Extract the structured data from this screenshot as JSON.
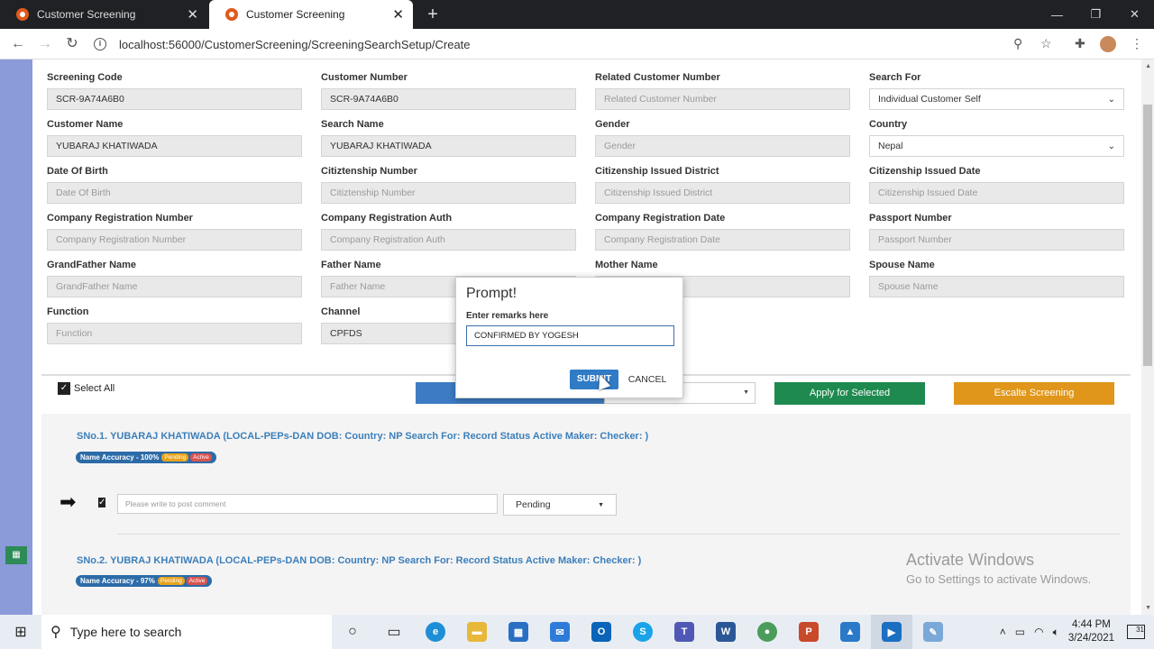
{
  "browser": {
    "tabs": [
      {
        "title": "Customer Screening",
        "active": false
      },
      {
        "title": "Customer Screening",
        "active": true
      }
    ],
    "url": "localhost:56000/CustomerScreening/ScreeningSearchSetup/Create"
  },
  "form": {
    "fields": [
      {
        "label": "Screening Code",
        "value": "SCR-9A74A6B0",
        "placeholder": false
      },
      {
        "label": "Customer Number",
        "value": "SCR-9A74A6B0",
        "placeholder": false
      },
      {
        "label": "Related Customer Number",
        "value": "Related Customer Number",
        "placeholder": true
      },
      {
        "label": "Search For",
        "value": "Individual Customer Self",
        "select": true
      },
      {
        "label": "Customer Name",
        "value": "YUBARAJ KHATIWADA",
        "placeholder": false
      },
      {
        "label": "Search Name",
        "value": "YUBARAJ KHATIWADA",
        "placeholder": false
      },
      {
        "label": "Gender",
        "value": "Gender",
        "placeholder": true
      },
      {
        "label": "Country",
        "value": "Nepal",
        "select": true
      },
      {
        "label": "Date Of Birth",
        "value": "Date Of Birth",
        "placeholder": true
      },
      {
        "label": "Citiztenship Number",
        "value": "Citiztenship Number",
        "placeholder": true
      },
      {
        "label": "Citizenship Issued District",
        "value": "Citizenship Issued District",
        "placeholder": true
      },
      {
        "label": "Citizenship Issued Date",
        "value": "Citizenship Issued Date",
        "placeholder": true
      },
      {
        "label": "Company Registration Number",
        "value": "Company Registration Number",
        "placeholder": true
      },
      {
        "label": "Company Registration Auth",
        "value": "Company Registration Auth",
        "placeholder": true
      },
      {
        "label": "Company Registration Date",
        "value": "Company Registration Date",
        "placeholder": true
      },
      {
        "label": "Passport Number",
        "value": "Passport Number",
        "placeholder": true
      },
      {
        "label": "GrandFather Name",
        "value": "GrandFather Name",
        "placeholder": true
      },
      {
        "label": "Father Name",
        "value": "Father Name",
        "placeholder": true
      },
      {
        "label": "Mother Name",
        "value": "",
        "placeholder": true
      },
      {
        "label": "Spouse Name",
        "value": "Spouse Name",
        "placeholder": true
      },
      {
        "label": "Function",
        "value": "Function",
        "placeholder": true
      },
      {
        "label": "Channel",
        "value": "CPFDS",
        "placeholder": false
      }
    ]
  },
  "actions": {
    "select_all": "Select All",
    "apply": "Apply for Selected",
    "escalate": "Escalte Screening"
  },
  "results": [
    {
      "title": "SNo.1. YUBARAJ KHATIWADA (LOCAL-PEPs-DAN DOB: Country: NP Search For: Record Status Active Maker: Checker: )",
      "accuracy": "Name Accuracy - 100%",
      "status_badge": "Pending",
      "record_badge": "Active",
      "comment_placeholder": "Please write to post comment",
      "status_value": "Pending"
    },
    {
      "title": "SNo.2. YUBRAJ KHATIWADA (LOCAL-PEPs-DAN DOB: Country: NP Search For: Record Status Active Maker: Checker: )",
      "accuracy": "Name Accuracy - 97%",
      "status_badge": "Pending",
      "record_badge": "Active"
    }
  ],
  "modal": {
    "title": "Prompt!",
    "label": "Enter remarks here",
    "input_value": "CONFIRMED BY YOGESH",
    "submit": "SUBMIT",
    "cancel": "CANCEL"
  },
  "watermark": {
    "line1": "Activate Windows",
    "line2": "Go to Settings to activate Windows."
  },
  "taskbar": {
    "search_placeholder": "Type here to search",
    "time": "4:44 PM",
    "date": "3/24/2021",
    "notifications": "31"
  }
}
